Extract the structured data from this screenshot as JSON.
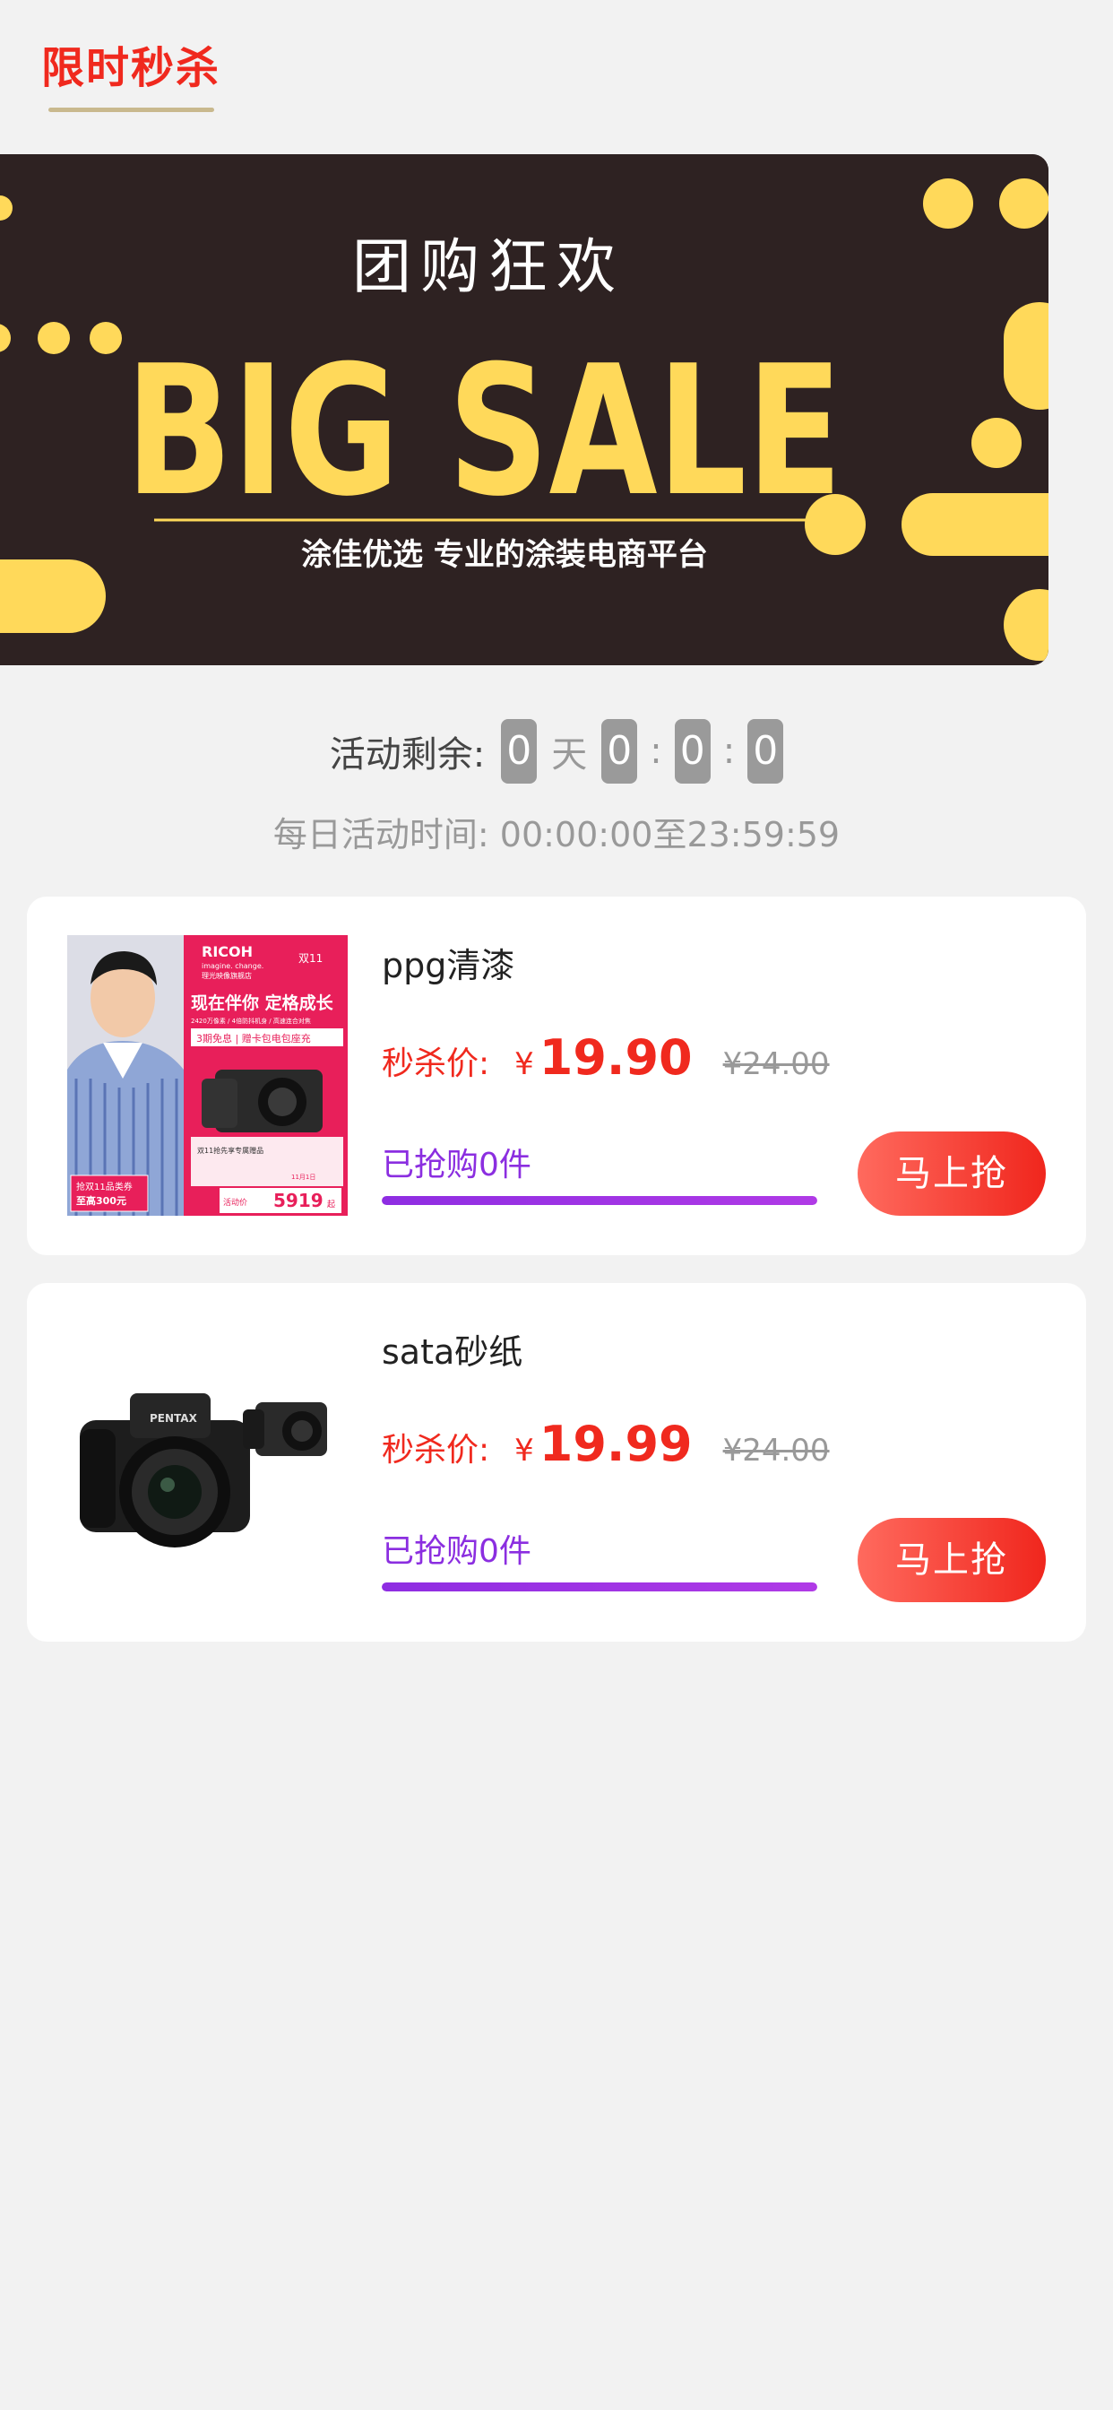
{
  "header": {
    "title": "限时秒杀"
  },
  "banner": {
    "headline": "团购狂欢",
    "big_text": "BIG SALE",
    "subtitle": "涂佳优选 专业的涂装电商平台"
  },
  "countdown": {
    "label": "活动剩余:",
    "days": "0",
    "day_unit": "天",
    "hours": "0",
    "minutes": "0",
    "seconds": "0",
    "sep": ":"
  },
  "daily_time": "每日活动时间: 00:00:00至23:59:59",
  "products": [
    {
      "name": "ppg清漆",
      "price_label": "秒杀价:",
      "currency": "¥",
      "price": "19.90",
      "old_price": "¥24.00",
      "sold": "已抢购0件",
      "progress": 1.0,
      "button": "马上抢",
      "image": {
        "brand": "RICOH",
        "tagline": "imagine. change.",
        "store": "理光映像旗舰店",
        "badge": "双11",
        "headline": "现在伴你 定格成长",
        "line1": "2420万像素 / 4倍防抖机身 / 高速连合对焦",
        "promo": "3期免息 | 赠卡包电包座充",
        "gift_note": "双11抢先享专属赠品",
        "coupon1": "抢双11品类券",
        "coupon2": "至高300元",
        "price_label": "活动价",
        "price": "5919",
        "price_suffix": "起",
        "date": "11月1日"
      }
    },
    {
      "name": "sata砂纸",
      "price_label": "秒杀价:",
      "currency": "¥",
      "price": "19.99",
      "old_price": "¥24.00",
      "sold": "已抢购0件",
      "progress": 1.0,
      "button": "马上抢",
      "image": {
        "brand": "PENTAX"
      }
    }
  ],
  "colors": {
    "accent": "#f0291e",
    "purple": "#8b2ee0",
    "banner_bg": "#2e2222",
    "banner_yellow": "#ffd95a"
  }
}
